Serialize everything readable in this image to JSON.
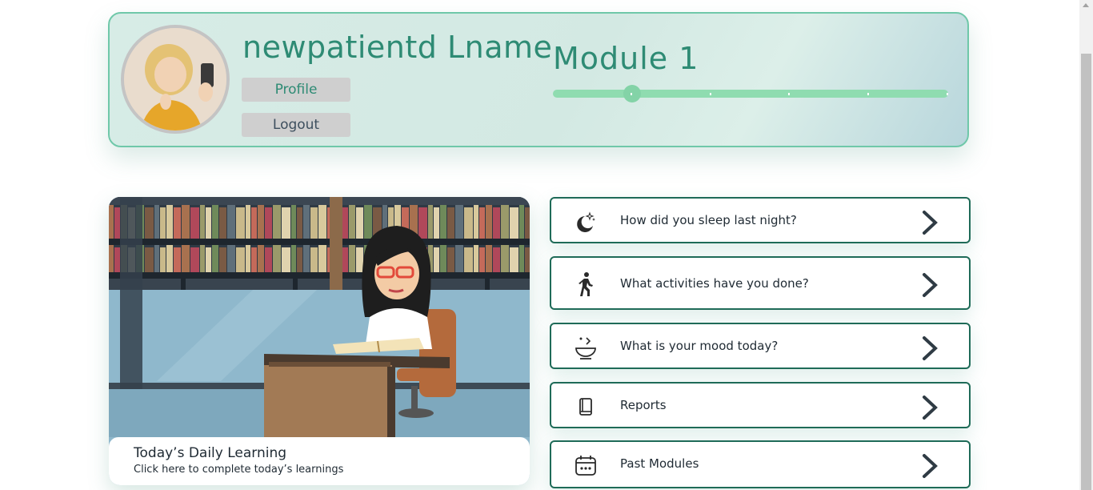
{
  "user": {
    "name": "newpatientd Lname",
    "profile_label": "Profile",
    "logout_label": "Logout"
  },
  "module": {
    "title": "Module 1",
    "progress_fraction": 0.2,
    "steps": 5
  },
  "learning": {
    "title": "Today’s Daily Learning",
    "subtitle": "Click here to complete today’s learnings"
  },
  "menu": [
    {
      "label": "How did you sleep last night?",
      "icon": "moon-stars-icon"
    },
    {
      "label": "What activities have you done?",
      "icon": "walking-person-icon"
    },
    {
      "label": "What is your mood today?",
      "icon": "mood-bowl-icon"
    },
    {
      "label": "Reports",
      "icon": "book-icon"
    },
    {
      "label": "Past Modules",
      "icon": "calendar-icon"
    }
  ],
  "colors": {
    "accent": "#2e8b74",
    "card_border": "#6fc8a9",
    "menu_border": "#1f6b58",
    "slider": "#8fdcb0"
  }
}
